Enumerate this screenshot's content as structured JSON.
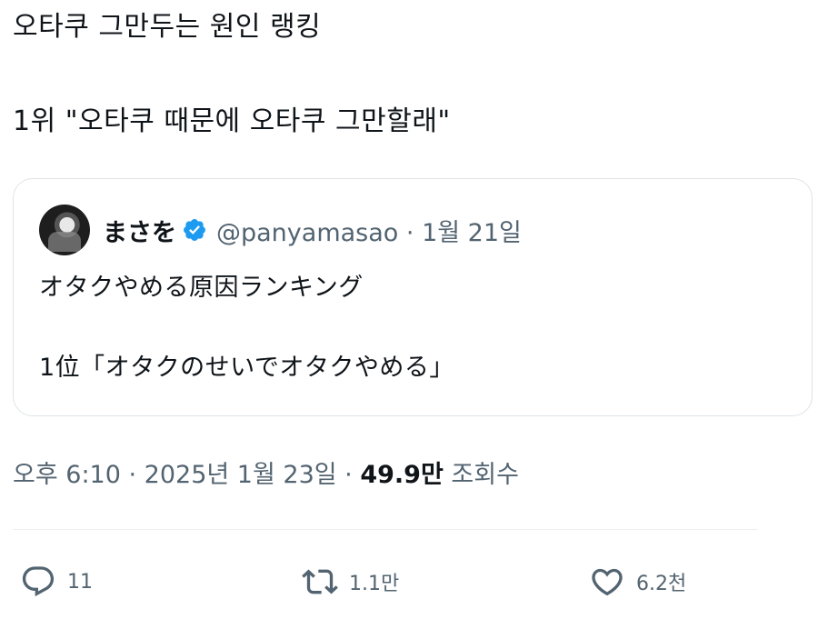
{
  "tweet": {
    "lines": [
      "오타쿠 그만두는 원인 랭킹",
      "",
      "1위 \"오타쿠 때문에 오타쿠 그만할래\""
    ]
  },
  "quote": {
    "display_name": "まさを",
    "handle": "@panyamasao",
    "separator": " · ",
    "date": "1월 21일",
    "body_lines": [
      "オタクやめる原因ランキング",
      "",
      "1位「オタクのせいでオタクやめる」"
    ],
    "verified_icon": "verified-badge-icon",
    "verified_color": "#1d9bf0"
  },
  "meta": {
    "time": "오후 6:10",
    "separator": " · ",
    "date": "2025년 1월 23일",
    "separator2": " · ",
    "views_count": "49.9만",
    "views_label": " 조회수"
  },
  "actions": {
    "reply": {
      "icon": "reply-icon",
      "count": "11"
    },
    "retweet": {
      "icon": "retweet-icon",
      "count": "1.1만"
    },
    "like": {
      "icon": "heart-icon",
      "count": "6.2천"
    }
  }
}
